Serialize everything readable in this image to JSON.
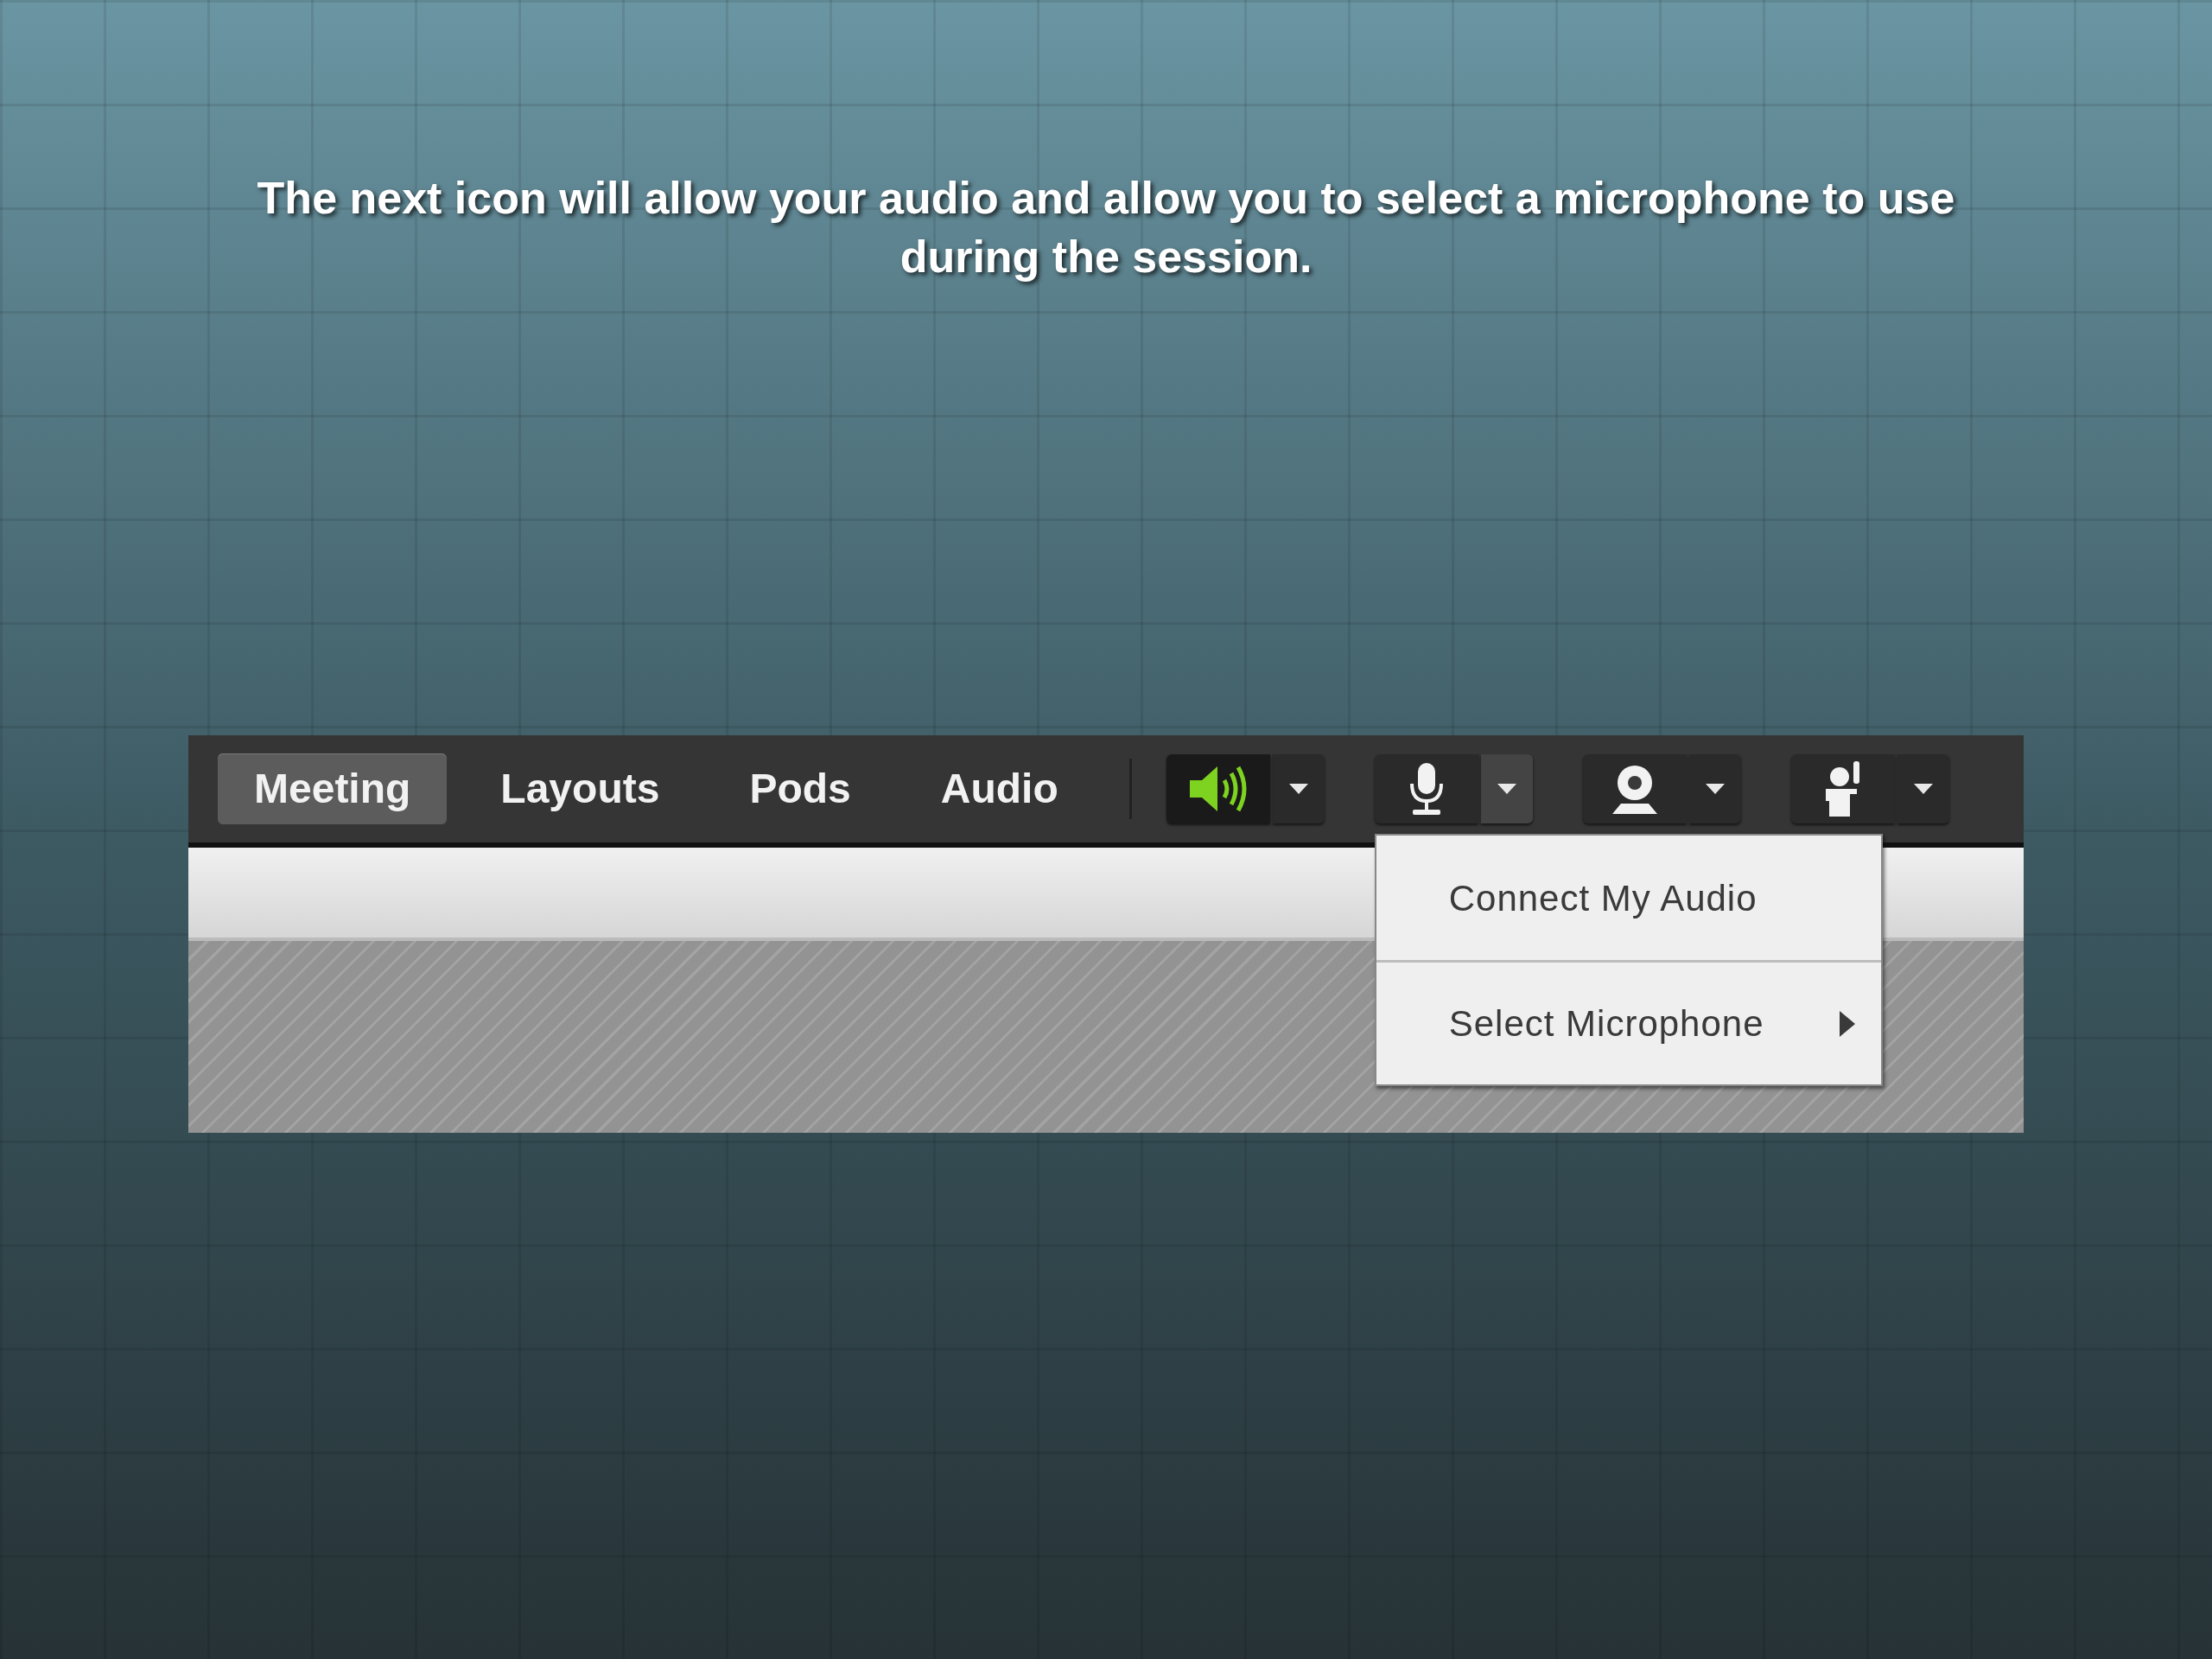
{
  "caption": "The next icon will allow your audio and allow you to select a microphone to use during the session.",
  "menu_tabs": [
    {
      "label": "Meeting",
      "selected": true
    },
    {
      "label": "Layouts",
      "selected": false
    },
    {
      "label": "Pods",
      "selected": false
    },
    {
      "label": "Audio",
      "selected": false
    }
  ],
  "toolbar_buttons": [
    {
      "kind": "speaker",
      "on": true,
      "expanded": false
    },
    {
      "kind": "microphone",
      "on": false,
      "expanded": true
    },
    {
      "kind": "camera",
      "on": false,
      "expanded": false
    },
    {
      "kind": "raise-hand",
      "on": false,
      "expanded": false
    }
  ],
  "microphone_menu": [
    {
      "label": "Connect My Audio",
      "submenu": false
    },
    {
      "label": "Select Microphone",
      "submenu": true
    }
  ]
}
